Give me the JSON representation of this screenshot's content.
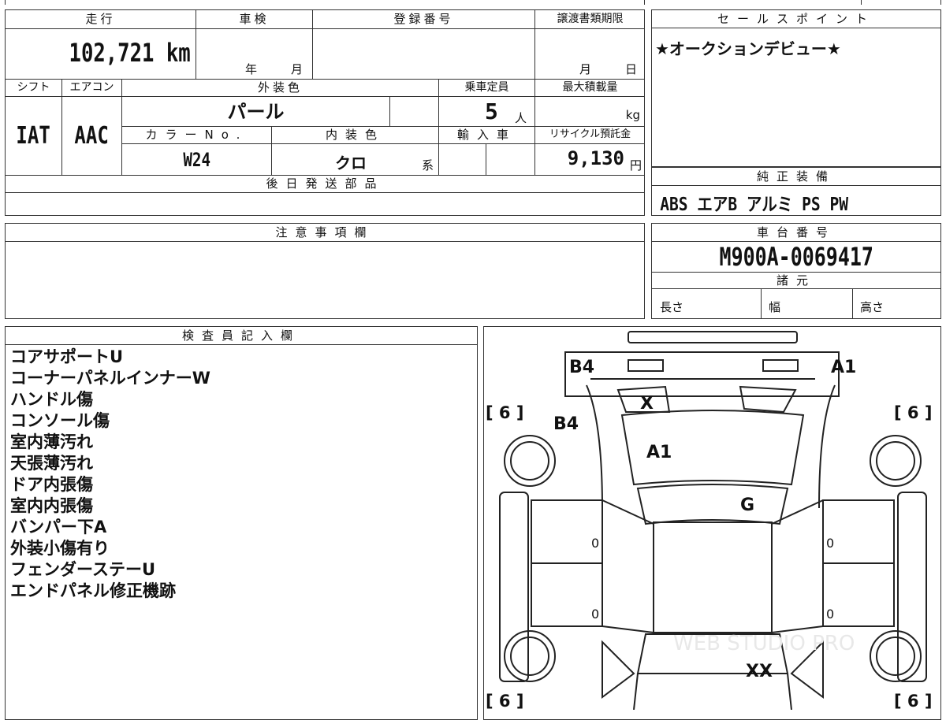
{
  "vehicle": {
    "mileage_label": "走行",
    "mileage": "102,721 km",
    "inspection_label": "車検",
    "inspection_year": "年",
    "inspection_month": "月",
    "registration_label": "登録番号",
    "transfer_label": "譲渡書類期限",
    "transfer_month": "月",
    "transfer_day": "日",
    "shift_label": "シフト",
    "shift": "IAT",
    "aircon_label": "エアコン",
    "aircon": "AAC",
    "exterior_label": "外装色",
    "exterior": "パール",
    "capacity_label": "乗車定員",
    "capacity": "5",
    "capacity_unit": "人",
    "maxload_label": "最大積載量",
    "maxload_unit": "kg",
    "colorno_label": "カラーNo.",
    "colorno": "W24",
    "interior_label": "内装色",
    "interior": "クロ",
    "interior_suffix": "系",
    "import_label": "輸入車",
    "recycle_label": "リサイクル預託金",
    "recycle": "9,130",
    "recycle_unit": "円"
  },
  "later_parts_label": "後日発送部品",
  "notes_label": "注意事項欄",
  "sales_point": {
    "label": "セールスポイント",
    "text": "★オークションデビュー★"
  },
  "equipment": {
    "label": "純正装備",
    "text": "ABS エアB アルミ PS PW"
  },
  "chassis": {
    "label": "車台番号",
    "number": "M900A-0069417"
  },
  "specs": {
    "label": "諸元",
    "length": "長さ",
    "width": "幅",
    "height": "高さ"
  },
  "inspector": {
    "label": "検査員記入欄",
    "lines": [
      "コアサポートU",
      "コーナーパネルインナーW",
      "ハンドル傷",
      "コンソール傷",
      "室内薄汚れ",
      "天張薄汚れ",
      "ドア内張傷",
      "室内内張傷",
      "バンパー下A",
      "外装小傷有り",
      "フェンダーステーU",
      "エンドパネル修正機跡"
    ]
  },
  "diagram": {
    "marks": {
      "b4_top": "B4",
      "a1_top": "A1",
      "x": "X",
      "b4_left": "B4",
      "a1_center": "A1",
      "g": "G",
      "xx": "XX",
      "zero_1": "0",
      "zero_2": "0",
      "zero_3": "0",
      "zero_4": "0"
    },
    "tires": {
      "front_left": "[ 6 ]",
      "front_right": "[ 6 ]",
      "rear_left": "[ 6 ]",
      "rear_right": "[ 6 ]"
    },
    "watermark": "WEB STUDIO PRO"
  }
}
